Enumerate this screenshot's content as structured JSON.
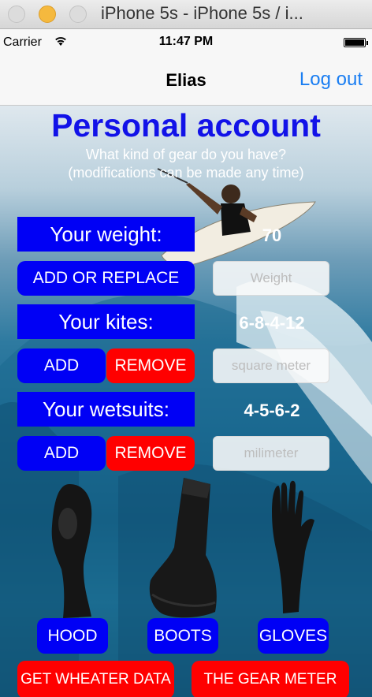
{
  "window": {
    "title": "iPhone 5s - iPhone 5s / i..."
  },
  "status": {
    "carrier": "Carrier",
    "time": "11:47 PM"
  },
  "nav": {
    "title": "Elias",
    "logout_label": "Log out"
  },
  "main": {
    "heading": "Personal account",
    "subtitle_1": "What kind of gear do you have?",
    "subtitle_2": "(modifications can be made any time)",
    "weight": {
      "label": "Your weight:",
      "value": "70",
      "button": "ADD OR REPLACE",
      "placeholder": "Weight"
    },
    "kites": {
      "label": "Your kites:",
      "value": "6-8-4-12",
      "add": "ADD",
      "remove": "REMOVE",
      "placeholder": "square meter"
    },
    "wetsuits": {
      "label": "Your wetsuits:",
      "value": "4-5-6-2",
      "add": "ADD",
      "remove": "REMOVE",
      "placeholder": "milimeter"
    },
    "gear_buttons": {
      "hood": "HOOD",
      "boots": "BOOTS",
      "gloves": "GLOVES"
    },
    "bottom": {
      "weather": "GET WHEATER DATA",
      "gear_meter": "THE GEAR METER"
    }
  },
  "colors": {
    "accent_blue": "#0000f5",
    "alert_red": "#ff0000",
    "ios_link": "#1a7ef2",
    "heading": "#1212e8"
  }
}
